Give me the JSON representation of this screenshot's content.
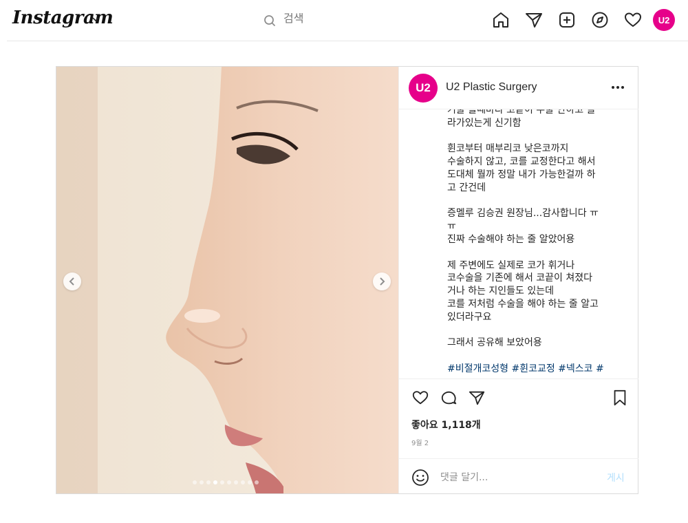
{
  "nav": {
    "logo": "Instagram",
    "search_placeholder": "검색",
    "avatar_text": "U2",
    "icons": [
      "home-icon",
      "direct-icon",
      "new-post-icon",
      "explore-icon",
      "activity-icon"
    ]
  },
  "post": {
    "username": "U2 Plastic Surgery",
    "avatar_text": "U2",
    "brand_color": "#e6008a",
    "carousel": {
      "slide_count": 10,
      "active_index": 3
    },
    "caption_lines": [
      "거울 볼때마다 코끝이 수술 안하고 올",
      "라가있는게 신기함",
      "",
      "휜코부터 매부리코 낮은코까지",
      "수술하지 않고, 코를 교정한다고 해서",
      "도대체 뭘까 정말 내가 가능한걸까 하",
      "고 간건데",
      "",
      "증멜루 김승권 원장님...감사합니다 ㅠ",
      "ㅠ",
      "진짜 수술해야 하는 줄 알았어용",
      "",
      "제 주변에도 실제로 코가 휘거나",
      "코수술을 기존에 해서 코끝이 쳐졌다",
      "거나 하는 지인들도 있는데",
      "코를 저처럼 수술을 해야 하는 줄 알고",
      "있더라구요",
      "",
      "그래서 공유해 보았어용",
      ""
    ],
    "hashtags": "#비절개코성형 #휜코교정 #넥스코 #",
    "likes": "좋아요 1,118개",
    "date": "9월 2",
    "comment_placeholder": "댓글 달기...",
    "post_button": "게시"
  }
}
